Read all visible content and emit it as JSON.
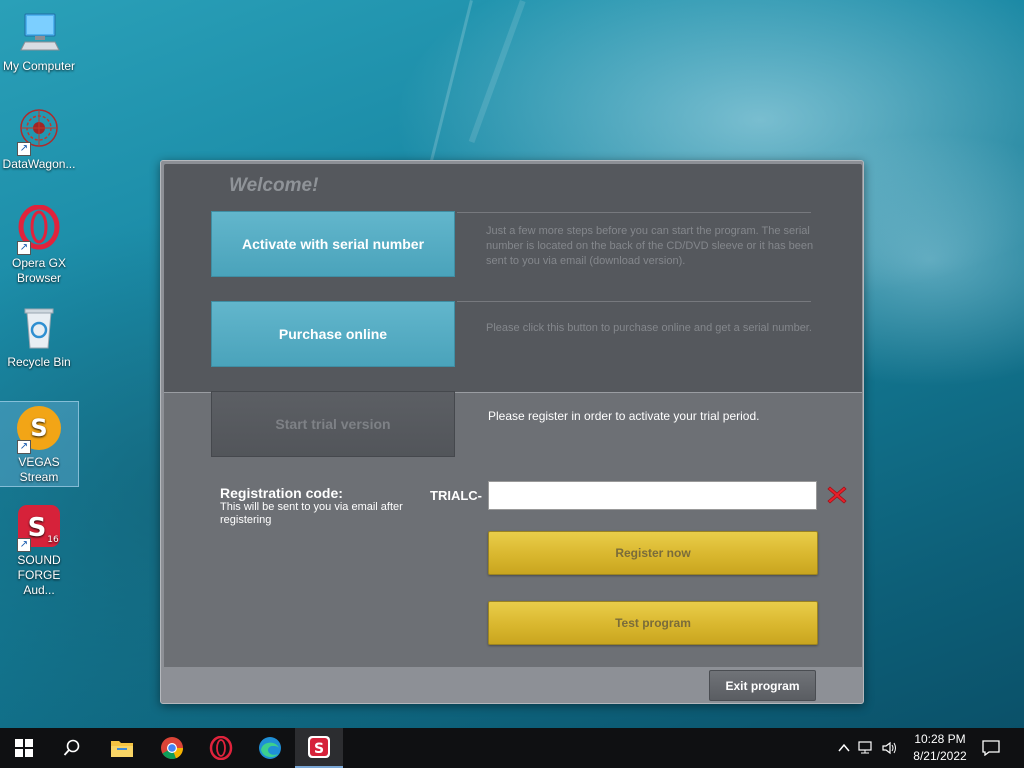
{
  "desktop": {
    "icons": [
      {
        "label": "My Computer"
      },
      {
        "label": "DataWagon..."
      },
      {
        "label": "Opera GX Browser"
      },
      {
        "label": "Recycle Bin"
      },
      {
        "label": "VEGAS Stream"
      },
      {
        "label": "SOUND FORGE Aud..."
      }
    ]
  },
  "dialog": {
    "welcome": "Welcome!",
    "activate_button": "Activate with serial number",
    "activate_desc": "Just a few more steps before you can start the program. The serial number is located on the back of the CD/DVD sleeve or it has been sent to you via email (download version).",
    "purchase_button": "Purchase online",
    "purchase_desc": "Please click this button to purchase online and get a serial number.",
    "trial_button": "Start trial version",
    "trial_desc": "Please register in order to activate your trial period.",
    "reg_title": "Registration code:",
    "reg_subtitle": "This will be sent to you via email after registering",
    "code_prefix": "TRIALC-",
    "code_value": "",
    "register_button": "Register now",
    "test_button": "Test program",
    "exit_button": "Exit program"
  },
  "taskbar": {
    "time": "10:28 PM",
    "date": "8/21/2022",
    "pinned": [
      "windows-start",
      "search",
      "file-explorer",
      "chrome",
      "opera-gx",
      "edge",
      "sound-forge"
    ]
  },
  "colors": {
    "accent_blue": "#4aa3bb",
    "gold": "#d9b72e",
    "dialog_dark": "#55585d"
  }
}
